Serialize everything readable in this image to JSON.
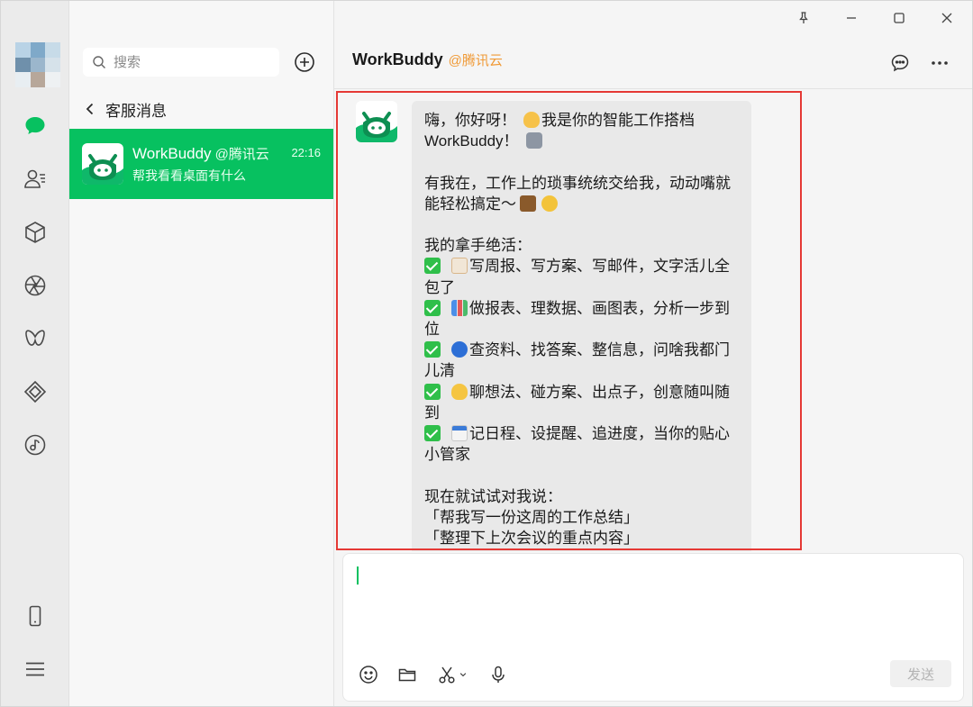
{
  "window": {
    "controls": [
      "pin-icon",
      "minimize-icon",
      "maximize-icon",
      "close-icon"
    ]
  },
  "rail": {
    "items": [
      "chat-icon",
      "contacts-icon",
      "cube-icon",
      "aperture-icon",
      "butterfly-icon",
      "diamond-icon",
      "music-icon",
      "phone-icon",
      "menu-icon"
    ],
    "active_color": "#07c160"
  },
  "sidebar": {
    "search_placeholder": "搜索",
    "back_label": "客服消息",
    "conversations": [
      {
        "name": "WorkBuddy",
        "org": "@腾讯云",
        "time": "22:16",
        "preview": "帮我看看桌面有什么",
        "selected_color": "#07c160"
      }
    ]
  },
  "chat": {
    "title": "WorkBuddy",
    "org": "@腾讯云",
    "org_color": "#f09a37",
    "message": {
      "l1": "嗨，你好呀！",
      "l1b": "我是你的智能工作搭档",
      "l2": "WorkBuddy！",
      "l3": "有我在，工作上的琐事统统交给我，动动嘴就",
      "l4": "能轻松搞定～",
      "l5": "我的拿手绝活：",
      "i1a": "写周报、写方案、写邮件，文字活儿全",
      "i1b": "包了",
      "i2a": "做报表、理数据、画图表，分析一步到",
      "i2b": "位",
      "i3a": "查资料、找答案、整信息，问啥我都门",
      "i3b": "儿清",
      "i4a": "聊想法、碰方案、出点子，创意随叫随",
      "i4b": "到",
      "i5a": "记日程、设提醒、追进度，当你的贴心",
      "i5b": "小管家",
      "l6": "现在就试试对我说：",
      "q1": "「帮我写一份这周的工作总结」",
      "q2": "「整理下上次会议的重点内容」"
    },
    "highlight_color": "#e53935"
  },
  "composer": {
    "tools": [
      "emoji-icon",
      "folder-icon",
      "scissors-icon",
      "mic-icon"
    ],
    "send_label": "发送"
  }
}
